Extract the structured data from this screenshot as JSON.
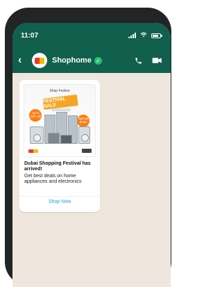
{
  "status_bar": {
    "time": "11:07"
  },
  "chat_header": {
    "name": "Shophome",
    "back_icon": "back-arrow-icon",
    "call_icon": "phone-icon",
    "video_icon": "video-camera-icon"
  },
  "message": {
    "title": "Dubai Shopping Festival has arrived!",
    "body": "Get best deals on home appliances and electronics",
    "cta_label": "Shop Now",
    "banner": {
      "headline": "FESTIVAL SALE",
      "top_text": "Shop Festive",
      "left_offer": "Up to 40% off",
      "right_offer": "Special deals"
    }
  },
  "colors": {
    "app_bar": "#115f4d",
    "chat_bg": "#efe6dd",
    "link": "#1ba1e2",
    "verified": "#25c16f"
  }
}
